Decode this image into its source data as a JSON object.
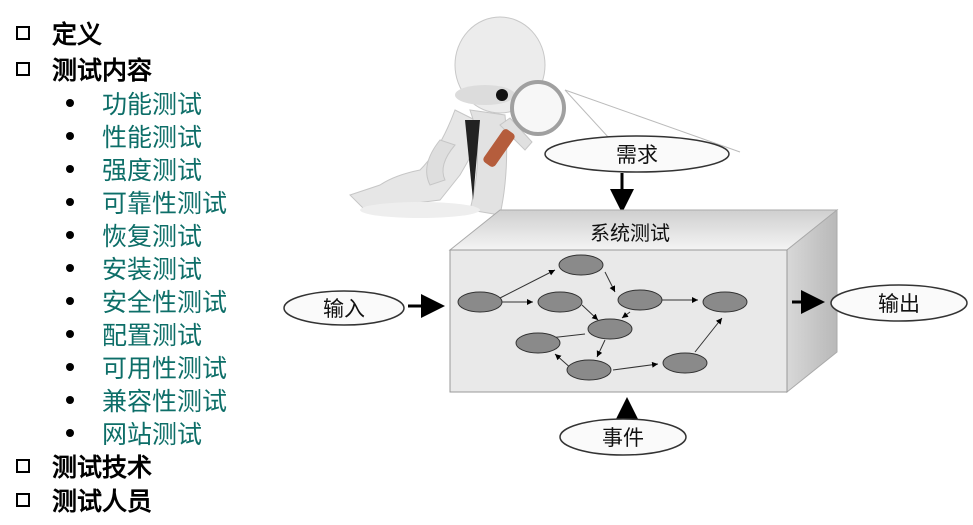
{
  "outline": {
    "items": [
      {
        "label": "定义"
      },
      {
        "label": "测试内容",
        "sub": [
          "功能测试",
          "性能测试",
          "强度测试",
          "可靠性测试",
          "恢复测试",
          "安装测试",
          "安全性测试",
          "配置测试",
          "可用性测试",
          "兼容性测试",
          "网站测试"
        ]
      },
      {
        "label": "测试技术"
      },
      {
        "label": "测试人员"
      }
    ]
  },
  "diagram": {
    "box_label": "系统测试",
    "requirement": "需求",
    "input": "输入",
    "output": "输出",
    "event": "事件"
  },
  "colors": {
    "sub_text": "#0d6e68",
    "box_front": "#e8e8e8",
    "node": "#8a8a8a"
  }
}
